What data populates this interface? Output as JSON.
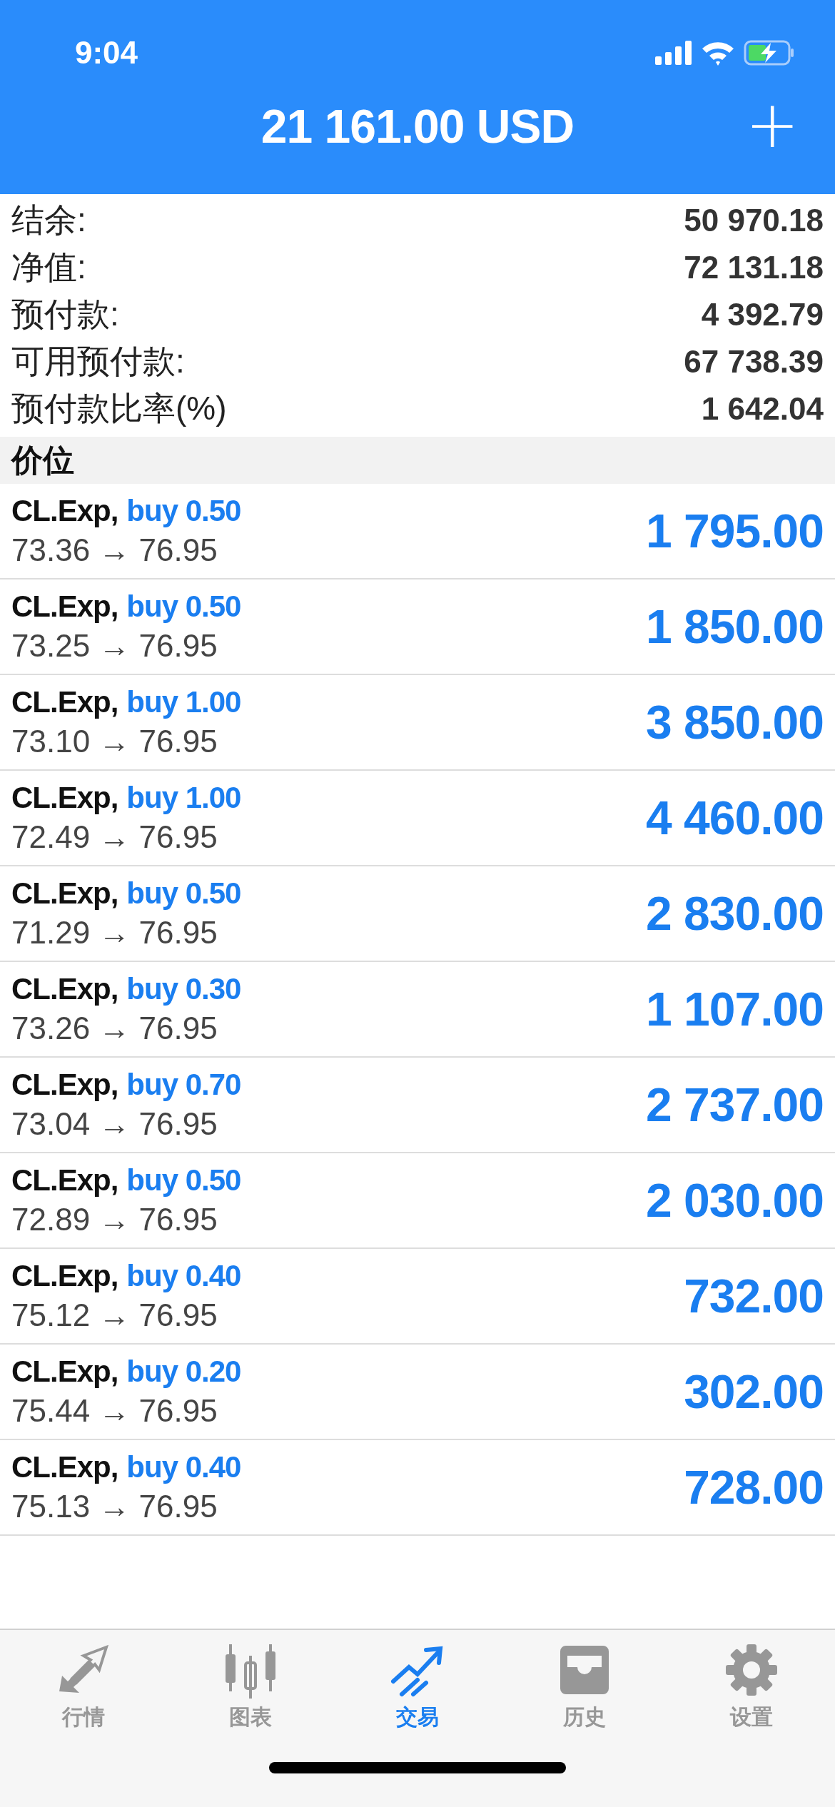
{
  "status_bar": {
    "time": "9:04"
  },
  "header": {
    "title": "21 161.00 USD",
    "add_button": "+"
  },
  "summary": [
    {
      "label": "结余:",
      "value": "50 970.18"
    },
    {
      "label": "净值:",
      "value": "72 131.18"
    },
    {
      "label": "预付款:",
      "value": "4 392.79"
    },
    {
      "label": "可用预付款:",
      "value": "67 738.39"
    },
    {
      "label": "预付款比率(%)",
      "value": "1 642.04"
    }
  ],
  "section_title": "价位",
  "positions": [
    {
      "symbol": "CL.Exp,",
      "side": "buy 0.50",
      "prices": "73.36 → 76.95",
      "profit": "1 795.00"
    },
    {
      "symbol": "CL.Exp,",
      "side": "buy 0.50",
      "prices": "73.25 → 76.95",
      "profit": "1 850.00"
    },
    {
      "symbol": "CL.Exp,",
      "side": "buy 1.00",
      "prices": "73.10 → 76.95",
      "profit": "3 850.00"
    },
    {
      "symbol": "CL.Exp,",
      "side": "buy 1.00",
      "prices": "72.49 → 76.95",
      "profit": "4 460.00"
    },
    {
      "symbol": "CL.Exp,",
      "side": "buy 0.50",
      "prices": "71.29 → 76.95",
      "profit": "2 830.00"
    },
    {
      "symbol": "CL.Exp,",
      "side": "buy 0.30",
      "prices": "73.26 → 76.95",
      "profit": "1 107.00"
    },
    {
      "symbol": "CL.Exp,",
      "side": "buy 0.70",
      "prices": "73.04 → 76.95",
      "profit": "2 737.00"
    },
    {
      "symbol": "CL.Exp,",
      "side": "buy 0.50",
      "prices": "72.89 → 76.95",
      "profit": "2 030.00"
    },
    {
      "symbol": "CL.Exp,",
      "side": "buy 0.40",
      "prices": "75.12 → 76.95",
      "profit": "732.00"
    },
    {
      "symbol": "CL.Exp,",
      "side": "buy 0.20",
      "prices": "75.44 → 76.95",
      "profit": "302.00"
    },
    {
      "symbol": "CL.Exp,",
      "side": "buy 0.40",
      "prices": "75.13 → 76.95",
      "profit": "728.00"
    }
  ],
  "tabs": [
    {
      "kind": "quotes",
      "label": "行情",
      "selected": false
    },
    {
      "kind": "chart",
      "label": "图表",
      "selected": false
    },
    {
      "kind": "trade",
      "label": "交易",
      "selected": true
    },
    {
      "kind": "history",
      "label": "历史",
      "selected": false
    },
    {
      "kind": "settings",
      "label": "设置",
      "selected": false
    }
  ]
}
